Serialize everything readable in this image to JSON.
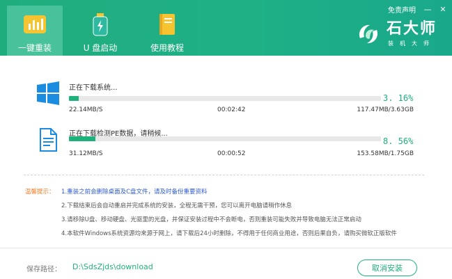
{
  "header": {
    "disclaimer_link": "免责声明",
    "minimize_glyph": "—",
    "close_glyph": "✕",
    "tabs": [
      {
        "label": "一键重装",
        "icon": "chart-bars-icon"
      },
      {
        "label": "U 盘启动",
        "icon": "usb-drive-icon"
      },
      {
        "label": "使用教程",
        "icon": "book-icon"
      }
    ],
    "brand": {
      "name": "石大师",
      "sub": "装机大师"
    }
  },
  "downloads": [
    {
      "title": "正在下载系统...",
      "percent_text": "3. 16%",
      "progress": 3.16,
      "speed": "22.14MB/S",
      "elapsed": "00:02:42",
      "size": "117.47MB/3.63GB",
      "icon": "windows-logo-icon"
    },
    {
      "title": "正在下载检测PE数据，请稍候...",
      "percent_text": "8. 56%",
      "progress": 8.56,
      "speed": "31.12MB/S",
      "elapsed": "00:00:52",
      "size": "153.58MB/1.75GB",
      "icon": "document-icon"
    }
  ],
  "tips": {
    "label": "温馨提示：",
    "lines": [
      "1.重装之前会删除桌面及C盘文件，请及时备份重要资料",
      "2.下载结束后会自动重启并完成系统的安装，全程无需干预，您可以离开电脑请稍作休息",
      "3.请移除U盘、移动硬盘、光驱里的光盘，并保证安装过程中不会断电，否则重装可能失败并导致电脑无法正常启动",
      "4.本软件Windows系统资源均来源于网上，请下载后24小时删除，不得用于任何商业用途，否则后果自负，请购买微软正版软件"
    ]
  },
  "footer": {
    "save_path_label": "保存路径：",
    "save_path": "D:\\SdsZjds\\download",
    "cancel_button": "取消安装"
  },
  "colors": {
    "accent": "#1db27b",
    "header_bg": "#20ad7e",
    "tip_label": "#f47b23",
    "tip_highlight": "#2c5bd6"
  }
}
